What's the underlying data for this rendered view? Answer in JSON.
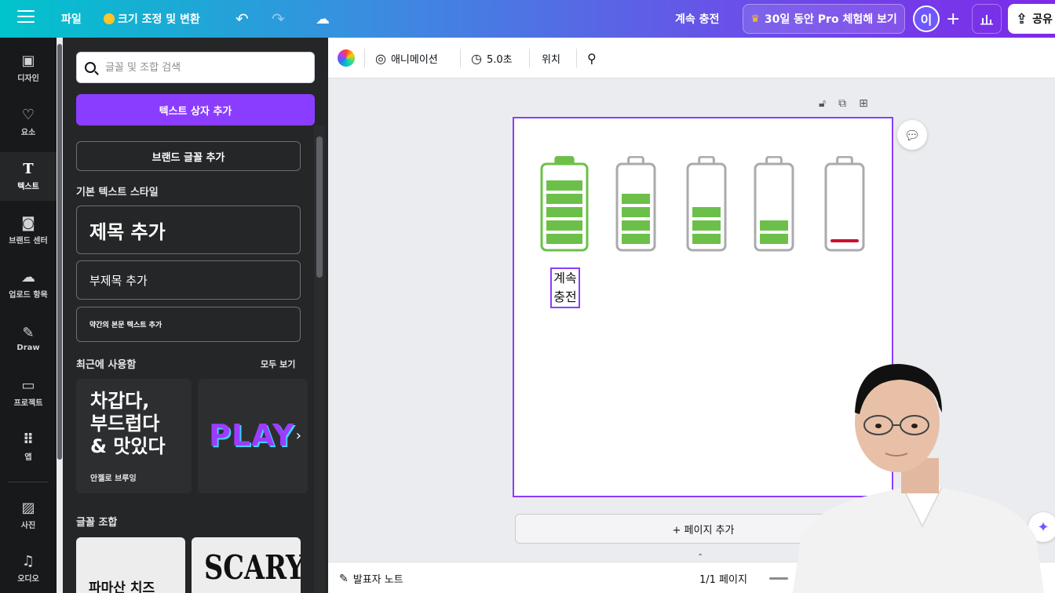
{
  "topbar": {
    "file_label": "파일",
    "resize_label": "크기 조정 및 변환",
    "doc_title": "계속 충전",
    "pro_trial_label": "30일 동안 Pro 체험해 보기",
    "avatar_initial": "이",
    "share_label": "공유"
  },
  "rail": {
    "items": [
      {
        "label": "디자인",
        "icon": "layout-icon"
      },
      {
        "label": "요소",
        "icon": "shapes-icon"
      },
      {
        "label": "텍스트",
        "icon": "text-icon"
      },
      {
        "label": "브랜드 센터",
        "icon": "brand-icon"
      },
      {
        "label": "업로드 항목",
        "icon": "upload-icon"
      },
      {
        "label": "Draw",
        "icon": "draw-icon"
      },
      {
        "label": "프로젝트",
        "icon": "folder-icon"
      },
      {
        "label": "앱",
        "icon": "apps-icon"
      },
      {
        "label": "사진",
        "icon": "photo-icon"
      },
      {
        "label": "오디오",
        "icon": "audio-icon"
      }
    ],
    "active_index": 2
  },
  "panel": {
    "search_placeholder": "글꼴 및 조합 검색",
    "add_text_box": "텍스트 상자 추가",
    "add_brand_font": "브랜드 글꼴 추가",
    "default_styles_heading": "기본 텍스트 스타일",
    "heading_style": "제목 추가",
    "subheading_style": "부제목 추가",
    "body_style": "약간의 본문 텍스트 추가",
    "recent_heading": "최근에 사용함",
    "see_all": "모두 보기",
    "recent": [
      {
        "text": "차갑다,\n부드럽다\n& 맛있다",
        "caption": "안젤로 브루잉"
      },
      {
        "text": "PLAY"
      }
    ],
    "combos_heading": "글꼴 조합",
    "combos": [
      {
        "text": "파마산 치즈"
      },
      {
        "text": "SCARY"
      }
    ]
  },
  "context_toolbar": {
    "animation_label": "애니메이션",
    "duration_label": "5.0초",
    "position_label": "위치"
  },
  "canvas": {
    "selected_text": "계속 충전",
    "batteries": [
      {
        "level_bars": 5,
        "color": "#6cc04a",
        "outline": "#6cc04a"
      },
      {
        "level_bars": 4,
        "color": "#6cc04a",
        "outline": "#a9abae"
      },
      {
        "level_bars": 3,
        "color": "#6cc04a",
        "outline": "#a9abae"
      },
      {
        "level_bars": 2,
        "color": "#6cc04a",
        "outline": "#a9abae"
      },
      {
        "level_bars": 1,
        "color": "#c8102e",
        "outline": "#a9abae"
      }
    ],
    "add_page_label": "+ 페이지 추가"
  },
  "bottombar": {
    "notes_label": "발표자 노트",
    "page_count": "1/1 페이지"
  },
  "colors": {
    "accent": "#8b3dff",
    "battery_green": "#6cc04a",
    "battery_red": "#c8102e",
    "selection": "#8b3dff"
  }
}
